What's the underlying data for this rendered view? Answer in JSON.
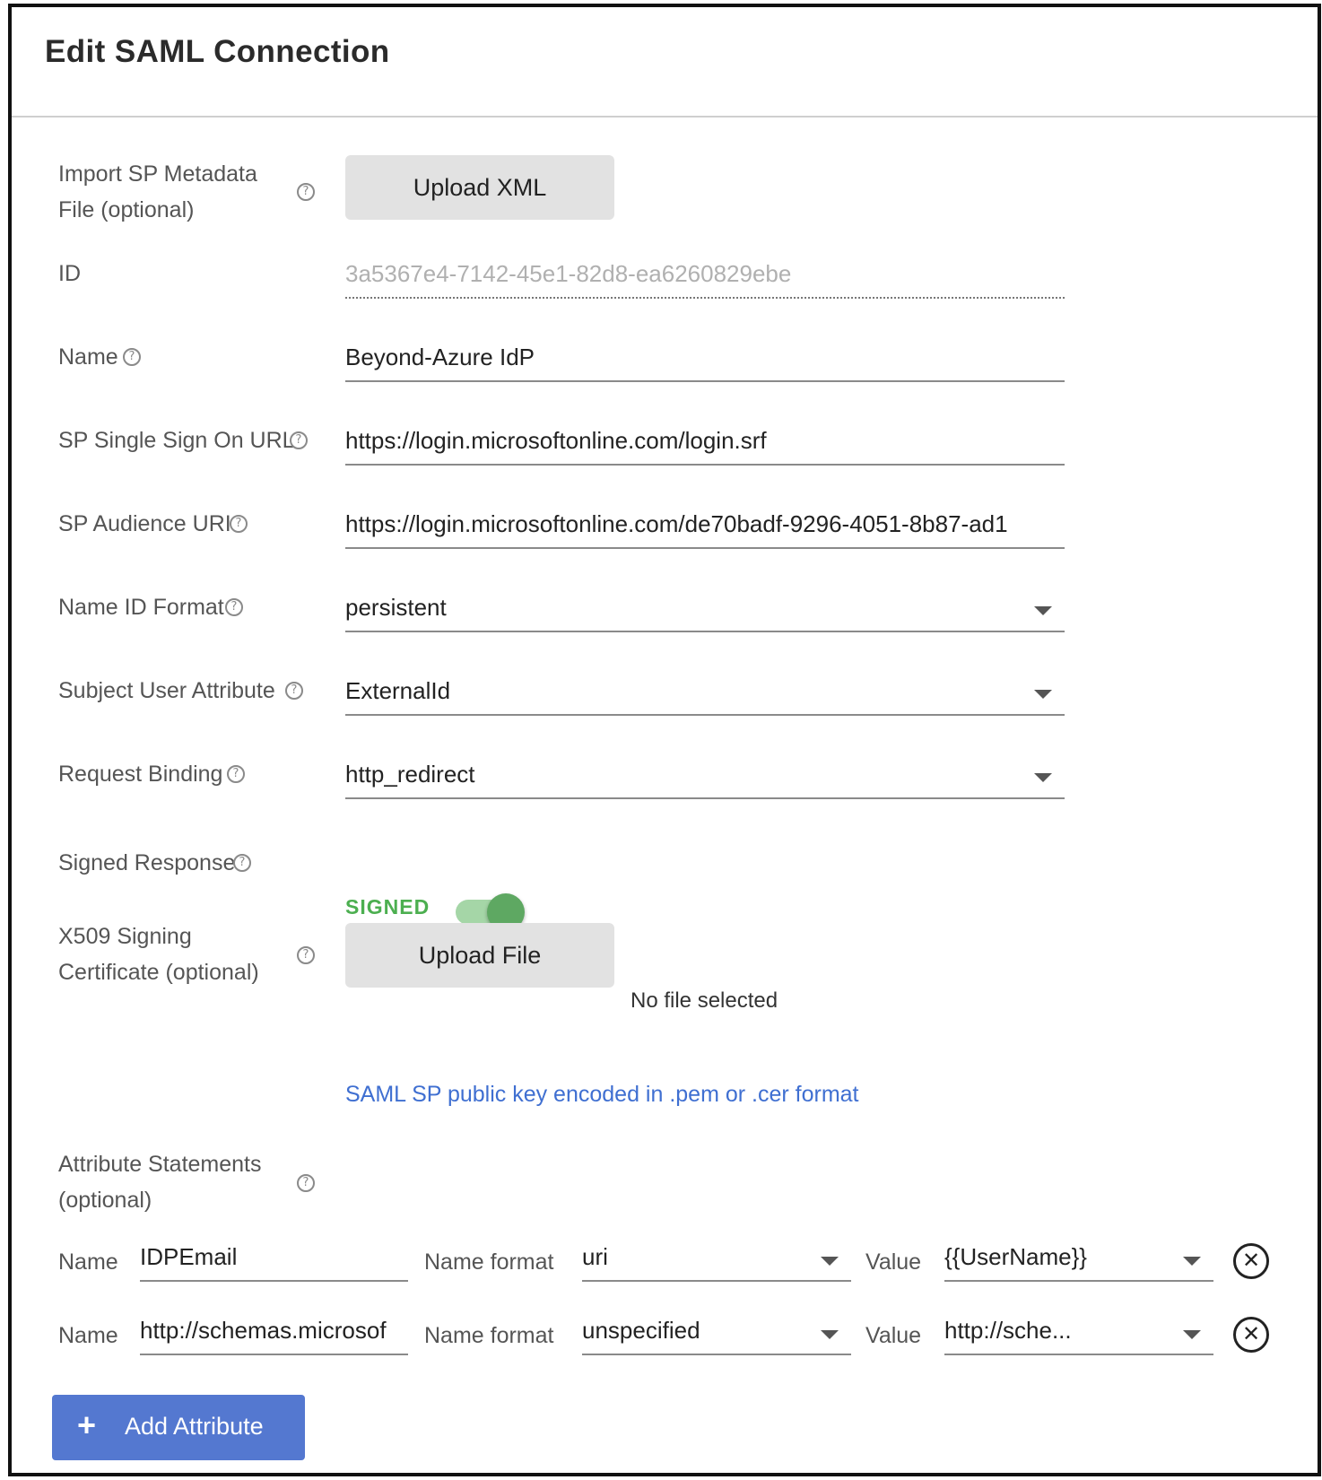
{
  "dialog": {
    "title": "Edit SAML Connection"
  },
  "import_metadata": {
    "label_line1": "Import SP Metadata",
    "label_line2": "File (optional)",
    "button": "Upload XML"
  },
  "id_field": {
    "label": "ID",
    "value": "3a5367e4-7142-45e1-82d8-ea6260829ebe"
  },
  "name_field": {
    "label": "Name",
    "value": "Beyond-Azure IdP"
  },
  "sso_url": {
    "label": "SP Single Sign On URL",
    "value": "https://login.microsoftonline.com/login.srf"
  },
  "audience_uri": {
    "label": "SP Audience URI",
    "value": "https://login.microsoftonline.com/de70badf-9296-4051-8b87-ad1"
  },
  "name_id_format": {
    "label": "Name ID Format",
    "value": "persistent"
  },
  "subject_user_attribute": {
    "label": "Subject User Attribute",
    "value": "ExternalId"
  },
  "request_binding": {
    "label": "Request Binding",
    "value": "http_redirect"
  },
  "signed_response": {
    "label": "Signed Response",
    "state_text": "SIGNED",
    "enabled": true,
    "accent_color": "#4caf50"
  },
  "x509": {
    "label_line1": "X509 Signing",
    "label_line2": "Certificate (optional)",
    "button": "Upload File",
    "file_status": "No file selected",
    "hint": "SAML SP public key encoded in .pem or .cer format"
  },
  "attribute_statements": {
    "label_line1": "Attribute Statements",
    "label_line2": "(optional)",
    "rows": [
      {
        "name_label": "Name",
        "name_value": "IDPEmail",
        "format_label": "Name format",
        "format_value": "uri",
        "value_label": "Value",
        "value_value": "{{UserName}}"
      },
      {
        "name_label": "Name",
        "name_value": "http://schemas.microsof",
        "format_label": "Name format",
        "format_value": "unspecified",
        "value_label": "Value",
        "value_value": "http://sche..."
      }
    ]
  },
  "add_attribute": {
    "icon": "plus-icon",
    "label": "Add Attribute",
    "color": "#5478d0"
  },
  "help_icon_glyph": "?",
  "remove_icon_glyph": "✕"
}
